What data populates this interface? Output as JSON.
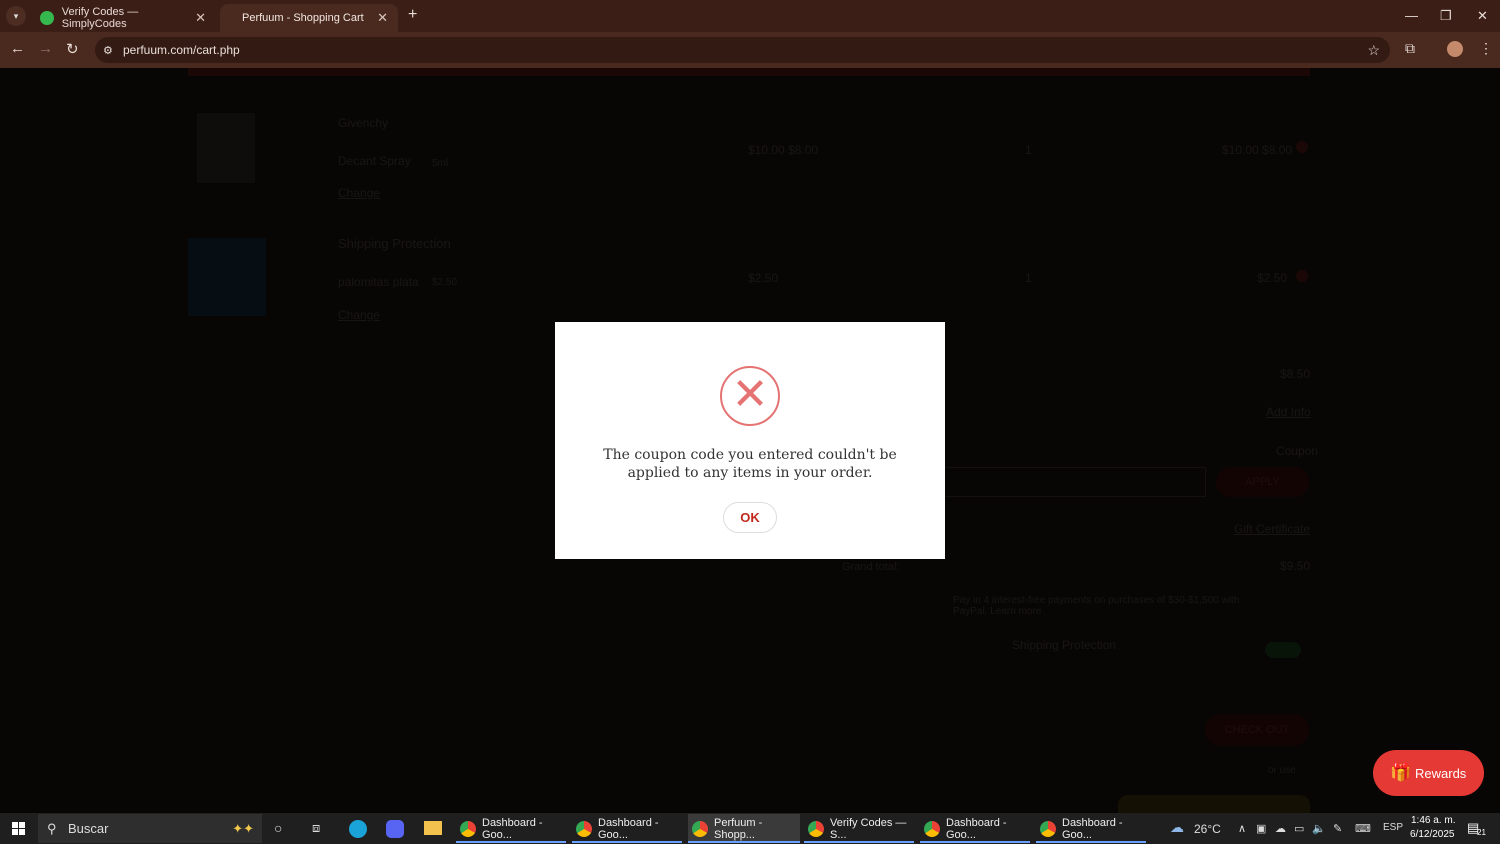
{
  "browser": {
    "tabs": [
      {
        "label": "Verify Codes — SimplyCodes",
        "active": false
      },
      {
        "label": "Perfuum - Shopping Cart",
        "active": true
      }
    ],
    "url": "perfuum.com/cart.php"
  },
  "cart": {
    "item1": {
      "brand": "Givenchy",
      "name": "Decant Spray",
      "size": "5ml",
      "change": "Change",
      "price": "$10.00 $8.00",
      "qty": "1",
      "total": "$10.00 $8.00"
    },
    "item2": {
      "title": "Shipping Protection",
      "name": "palomitas plata",
      "size": "$2.50",
      "change": "Change",
      "price": "$2.50",
      "qty": "1",
      "total": "$2.50"
    },
    "summary": {
      "subtotal": "$8.50",
      "add_info": "Add Info",
      "coupon": "Coupon",
      "apply": "APPLY",
      "gift": "Gift Certificate",
      "grand_total_label": "Grand total:",
      "grand_total": "$9.50",
      "paypal": "Pay in 4 interest-free payments on purchases of $30-$1,500 with PayPal. Learn more",
      "shipping_protection": "Shipping Protection",
      "checkout": "CHECK OUT",
      "or": "or use"
    }
  },
  "modal": {
    "message": "The coupon code you entered couldn't be applied to any items in your order.",
    "ok": "OK"
  },
  "rewards": {
    "label": "Rewards"
  },
  "taskbar": {
    "search": "Buscar",
    "apps": [
      {
        "label": "Dashboard - Goo..."
      },
      {
        "label": "Dashboard - Goo..."
      },
      {
        "label": "Perfuum - Shopp..."
      },
      {
        "label": "Verify Codes — S..."
      },
      {
        "label": "Dashboard - Goo..."
      },
      {
        "label": "Dashboard - Goo..."
      }
    ],
    "weather": "26°C",
    "lang": "ESP",
    "time": "1:46 a. m.",
    "date": "6/12/2025",
    "notif": "21"
  }
}
